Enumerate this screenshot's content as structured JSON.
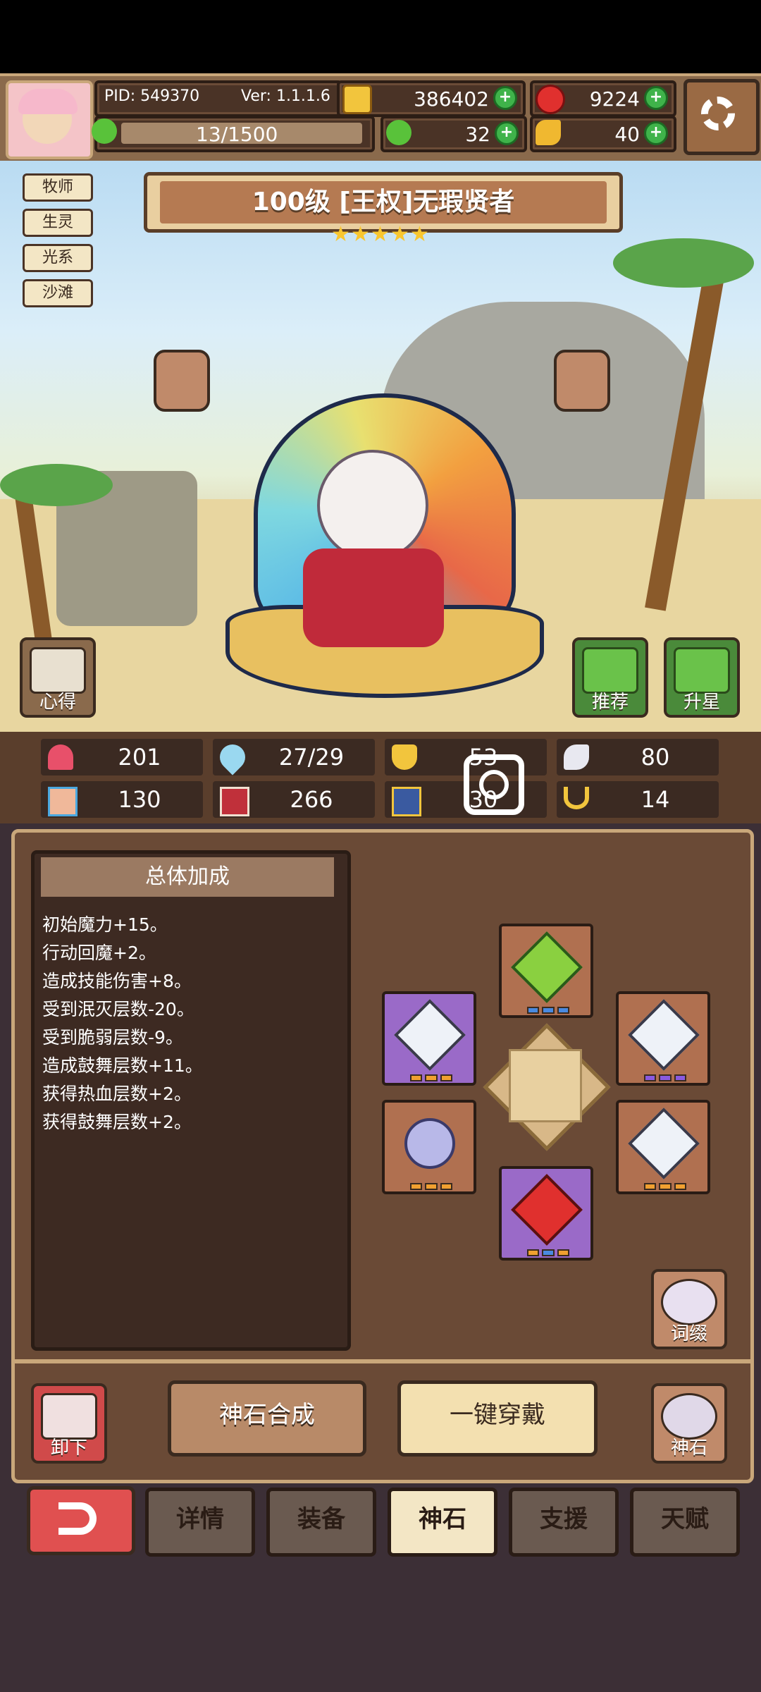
{
  "header": {
    "pid": "PID: 549370",
    "version": "Ver: 1.1.1.6",
    "gold": "386402",
    "gems": "9224",
    "energy": "13/1500",
    "clover": "32",
    "fish": "40"
  },
  "hero": {
    "title": "100级 [王权]无瑕贤者",
    "stars": 5,
    "tags": [
      "牧师",
      "生灵",
      "光系",
      "沙滩"
    ],
    "buttons": {
      "heart": "心得",
      "recommend": "推荐",
      "star_up": "升星"
    }
  },
  "stats": [
    {
      "icon": "heart-icon",
      "value": "201"
    },
    {
      "icon": "mana-drop-icon",
      "value": "27/29"
    },
    {
      "icon": "shield-icon",
      "value": "53"
    },
    {
      "icon": "wing-icon",
      "value": "80"
    },
    {
      "icon": "fist-icon",
      "value": "130"
    },
    {
      "icon": "book-icon",
      "value": "266"
    },
    {
      "icon": "boot-icon",
      "value": "30"
    },
    {
      "icon": "horseshoe-icon",
      "value": "14"
    }
  ],
  "bonus": {
    "header": "总体加成",
    "lines": [
      "初始魔力+15。",
      "行动回魔+2。",
      "造成技能伤害+8。",
      "受到泯灭层数-20。",
      "受到脆弱层数-9。",
      "造成鼓舞层数+11。",
      "获得热血层数+2。",
      "获得鼓舞层数+2。"
    ]
  },
  "actions": {
    "affix": "词缀",
    "unequip": "卸下",
    "synthesize": "神石合成",
    "equip_all": "一键穿戴",
    "godstone": "神石"
  },
  "tabs": [
    "详情",
    "装备",
    "神石",
    "支援",
    "天赋"
  ],
  "colors": {
    "gold_coin": "#f2c53d",
    "red_gem": "#e0302e",
    "green": "#3fb34a",
    "active_tab": "#f3e6c5"
  }
}
